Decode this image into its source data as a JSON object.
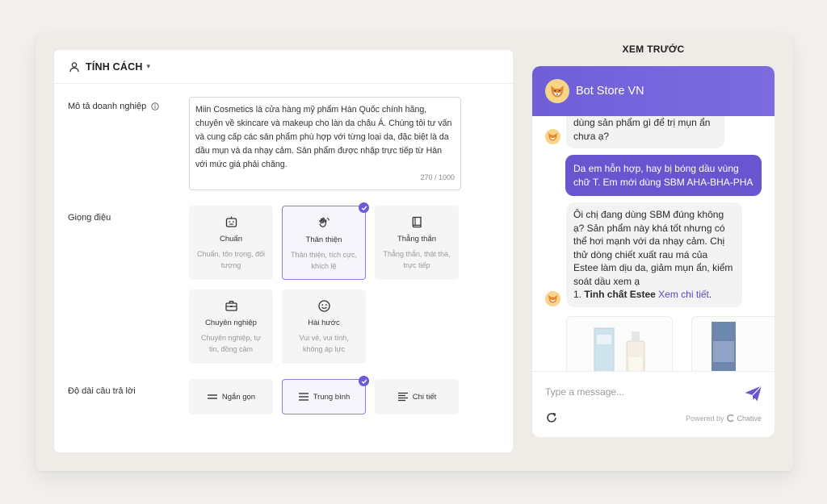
{
  "settings": {
    "section_title": "TÍNH CÁCH",
    "description": {
      "label": "Mô tả doanh nghiệp",
      "text": "Miin Cosmetics là cửa hàng mỹ phẩm Hàn Quốc chính hãng, chuyên về skincare và makeup cho làn da châu Á. Chúng tôi tư vấn và cung cấp các sản phẩm phù hợp với từng loại da, đặc biệt là da dầu mụn và da nhạy cảm. Sản phẩm được nhập trực tiếp từ Hàn với mức giá phải chăng.",
      "counter": "270 / 1000"
    },
    "tone": {
      "label": "Giọng điệu",
      "options": [
        {
          "title": "Chuẩn",
          "desc": "Chuẩn, tôn trọng, đối tượng",
          "icon": "robot-icon",
          "selected": false
        },
        {
          "title": "Thân thiện",
          "desc": "Thân thiện, tích cực, khích lệ",
          "icon": "wave-hand-icon",
          "selected": true
        },
        {
          "title": "Thẳng thắn",
          "desc": "Thẳng thắn, thật thà, trực tiếp",
          "icon": "book-icon",
          "selected": false
        },
        {
          "title": "Chuyên nghiệp",
          "desc": "Chuyên nghiệp, tự tin, đồng cảm",
          "icon": "briefcase-icon",
          "selected": false
        },
        {
          "title": "Hài hước",
          "desc": "Vui vẻ, vui tính, không áp lực",
          "icon": "smile-icon",
          "selected": false
        }
      ]
    },
    "length": {
      "label": "Độ dài câu trả lời",
      "options": [
        {
          "title": "Ngắn gọn",
          "icon": "lines-short-icon",
          "selected": false
        },
        {
          "title": "Trung bình",
          "icon": "lines-medium-icon",
          "selected": true
        },
        {
          "title": "Chi tiết",
          "icon": "lines-long-icon",
          "selected": false
        }
      ]
    }
  },
  "preview": {
    "title": "XEM TRƯỚC",
    "bot_name": "Bot Store VN",
    "messages": {
      "bot1": "dùng sản phẩm gì để trị mụn ẩn chưa ạ?",
      "user1": "Da em hỗn hợp, hay bị bóng dầu vùng chữ T. Em mới dùng SBM AHA-BHA-PHA",
      "bot2_text": "Ôi chị đang dùng SBM đúng không ạ? Sản phẩm này khá tốt nhưng có thể hơi mạnh với da nhạy cảm. Chị thử dòng chiết xuất rau má của Estee làm dịu da, giảm mụn ẩn, kiểm soát dầu xem ạ",
      "bot2_item_prefix": "1. ",
      "bot2_item_bold": "Tinh chất Estee",
      "bot2_item_link": "Xem chi tiết",
      "bot2_item_suffix": "."
    },
    "input_placeholder": "Type a message...",
    "powered_by": "Powered by",
    "brand": "Chative"
  },
  "colors": {
    "accent": "#6a55d0",
    "header_gradient_start": "#6f5ed8",
    "selected_border": "#8a80e0"
  }
}
